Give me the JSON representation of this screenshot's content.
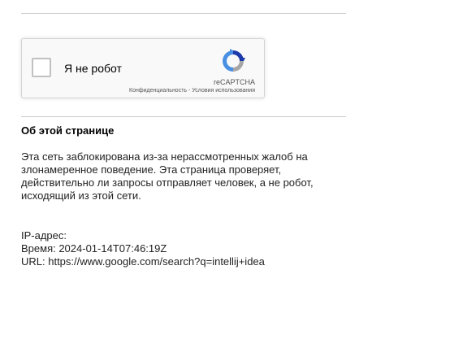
{
  "recaptcha": {
    "checkbox_label": "Я не робот",
    "brand": "reCAPTCHA",
    "privacy_link": "Конфиденциальность",
    "separator": " - ",
    "terms_link": "Условия использования",
    "logo_icon": "recaptcha-logo-icon",
    "colors": {
      "logo_blue": "#4a90e2",
      "logo_dark_blue": "#1c3aa9",
      "logo_gray": "#a6a6a6"
    }
  },
  "about": {
    "heading": "Об этой странице",
    "lines": [
      "Эта сеть заблокирована из-за нерассмотренных жалоб на",
      "злонамеренное поведение. Эта страница проверяет,",
      "действительно ли запросы отправляет человек, а не робот,",
      "исходящий из этой сети."
    ]
  },
  "info": {
    "ip_line": "IP-адрес:",
    "time_line": "Время: 2024-01-14T07:46:19Z",
    "url_line": "URL: https://www.google.com/search?q=intellij+idea"
  }
}
